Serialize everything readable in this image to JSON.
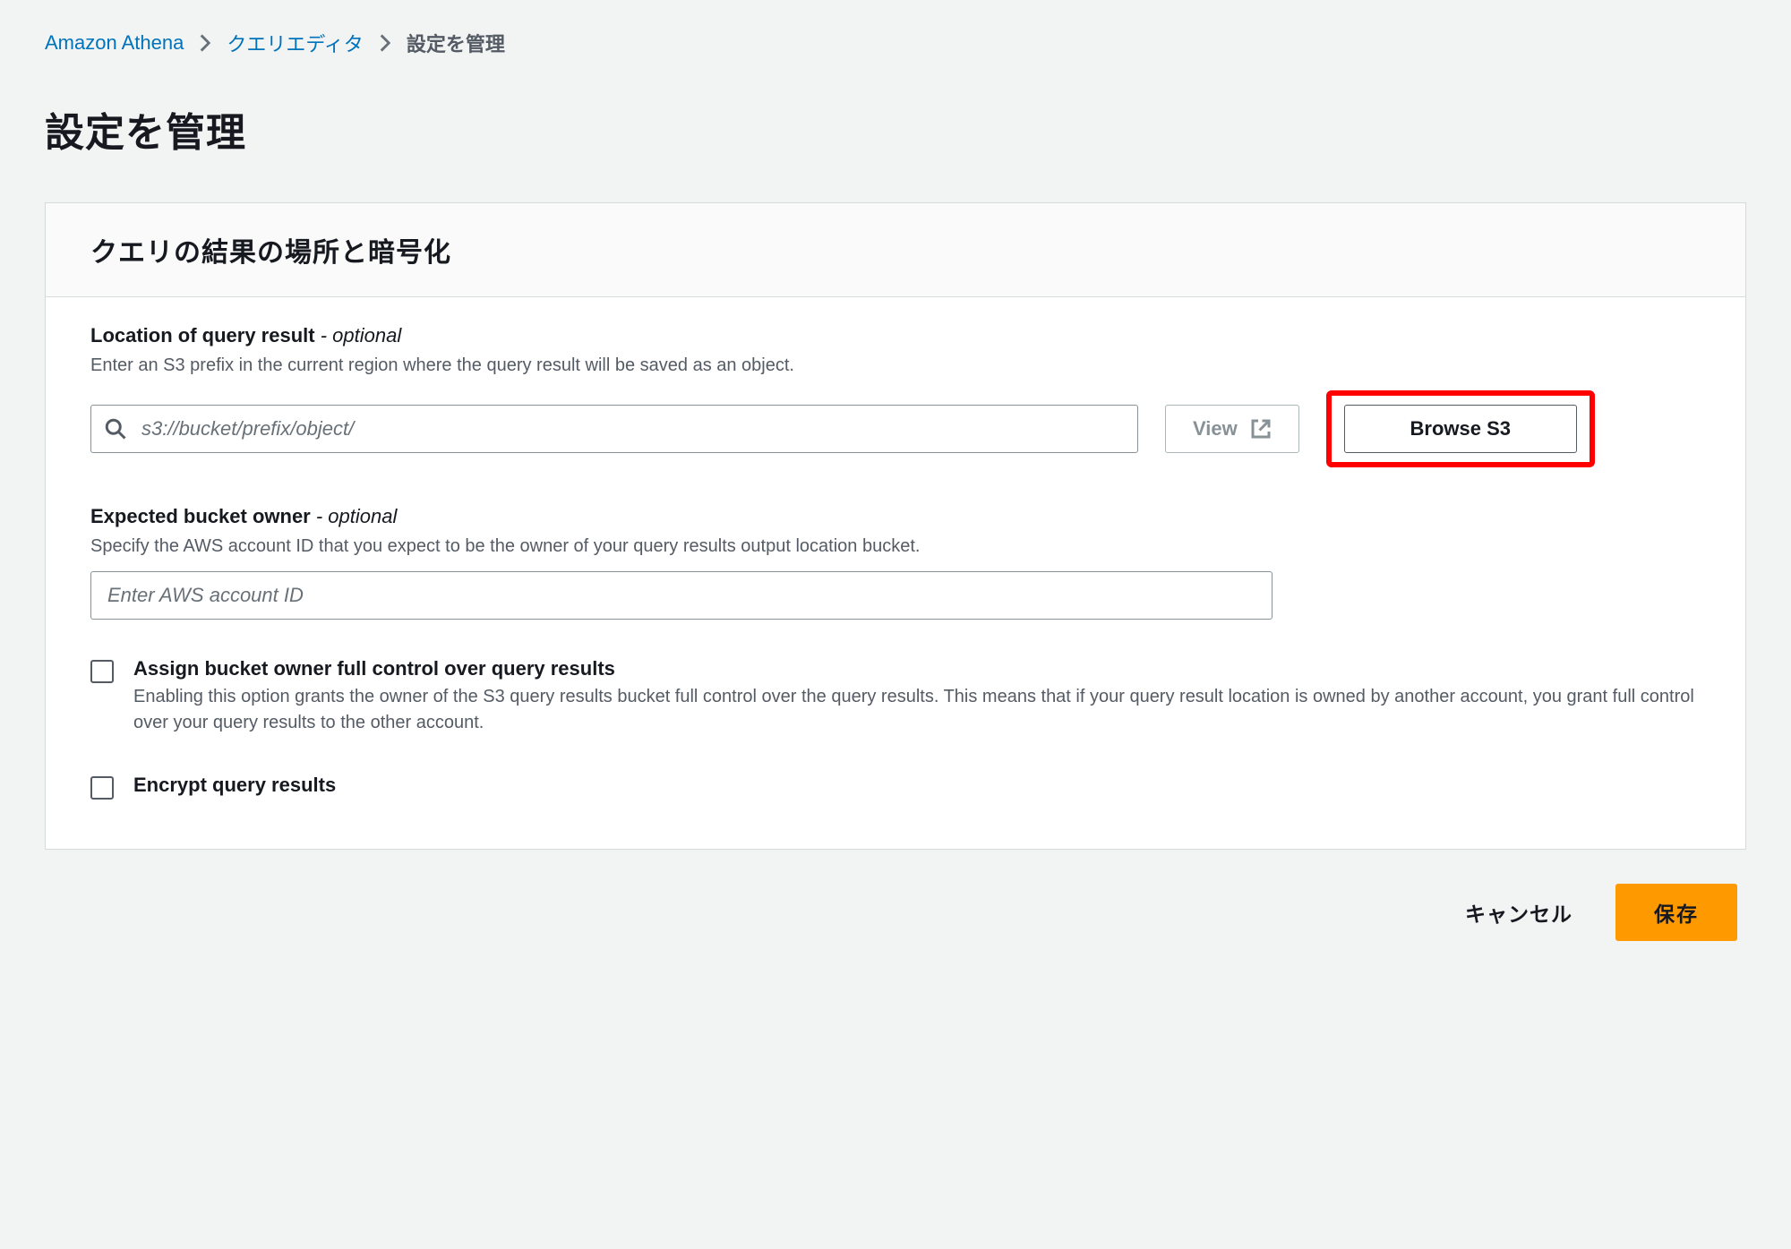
{
  "breadcrumb": {
    "service": "Amazon Athena",
    "editor": "クエリエディタ",
    "current": "設定を管理"
  },
  "page_title": "設定を管理",
  "panel": {
    "title": "クエリの結果の場所と暗号化",
    "location": {
      "label": "Location of query result",
      "optional_suffix": " - optional",
      "desc": "Enter an S3 prefix in the current region where the query result will be saved as an object.",
      "placeholder": "s3://bucket/prefix/object/",
      "view_label": "View",
      "browse_label": "Browse S3"
    },
    "owner": {
      "label": "Expected bucket owner",
      "optional_suffix": " - optional",
      "desc": "Specify the AWS account ID that you expect to be the owner of your query results output location bucket.",
      "placeholder": "Enter AWS account ID"
    },
    "assign_full_control": {
      "label": "Assign bucket owner full control over query results",
      "desc": "Enabling this option grants the owner of the S3 query results bucket full control over the query results. This means that if your query result location is owned by another account, you grant full control over your query results to the other account."
    },
    "encrypt": {
      "label": "Encrypt query results"
    }
  },
  "actions": {
    "cancel": "キャンセル",
    "save": "保存"
  }
}
